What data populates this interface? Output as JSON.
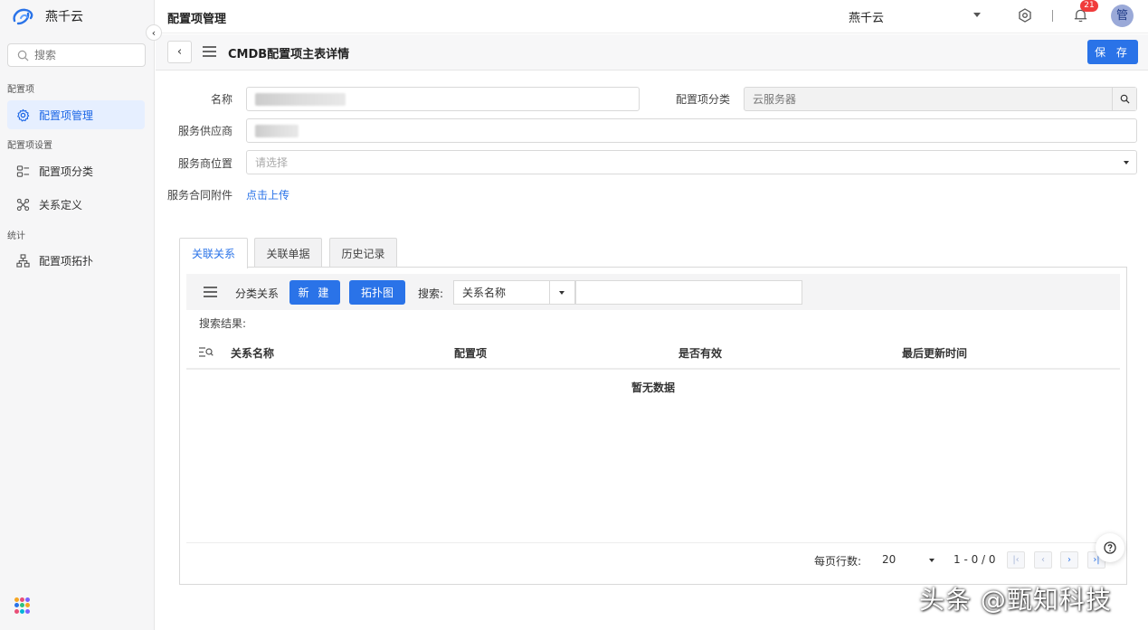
{
  "sidebar": {
    "brand": "燕千云",
    "search_placeholder": "搜索",
    "group_config": "配置项",
    "item_manage": "配置项管理",
    "group_settings": "配置项设置",
    "item_category": "配置项分类",
    "item_relation": "关系定义",
    "group_stats": "统计",
    "item_topology": "配置项拓扑"
  },
  "header": {
    "title": "配置项管理",
    "org": "燕千云",
    "notif_count": "21",
    "avatar": "管"
  },
  "subheader": {
    "title": "CMDB配置项主表详情",
    "save": "保 存"
  },
  "form": {
    "name_label": "名称",
    "category_label": "配置项分类",
    "category_value": "云服务器",
    "supplier_label": "服务供应商",
    "location_label": "服务商位置",
    "location_placeholder": "请选择",
    "contract_label": "服务合同附件",
    "upload_link": "点击上传"
  },
  "tabs": [
    "关联关系",
    "关联单据",
    "历史记录"
  ],
  "relations": {
    "toolbar_label": "分类关系",
    "new_button": "新 建",
    "topology_button": "拓扑图",
    "search_label": "搜索:",
    "search_field": "关系名称",
    "result_label": "搜索结果:",
    "columns": [
      "关系名称",
      "配置项",
      "是否有效",
      "最后更新时间"
    ],
    "empty": "暂无数据",
    "rows_per_page_label": "每页行数:",
    "rows_per_page": "20",
    "range": "1 - 0 / 0"
  },
  "watermark": "头条 @甄知科技",
  "colors": {
    "accent": "#2a73e8",
    "badge": "#f03c3c"
  }
}
